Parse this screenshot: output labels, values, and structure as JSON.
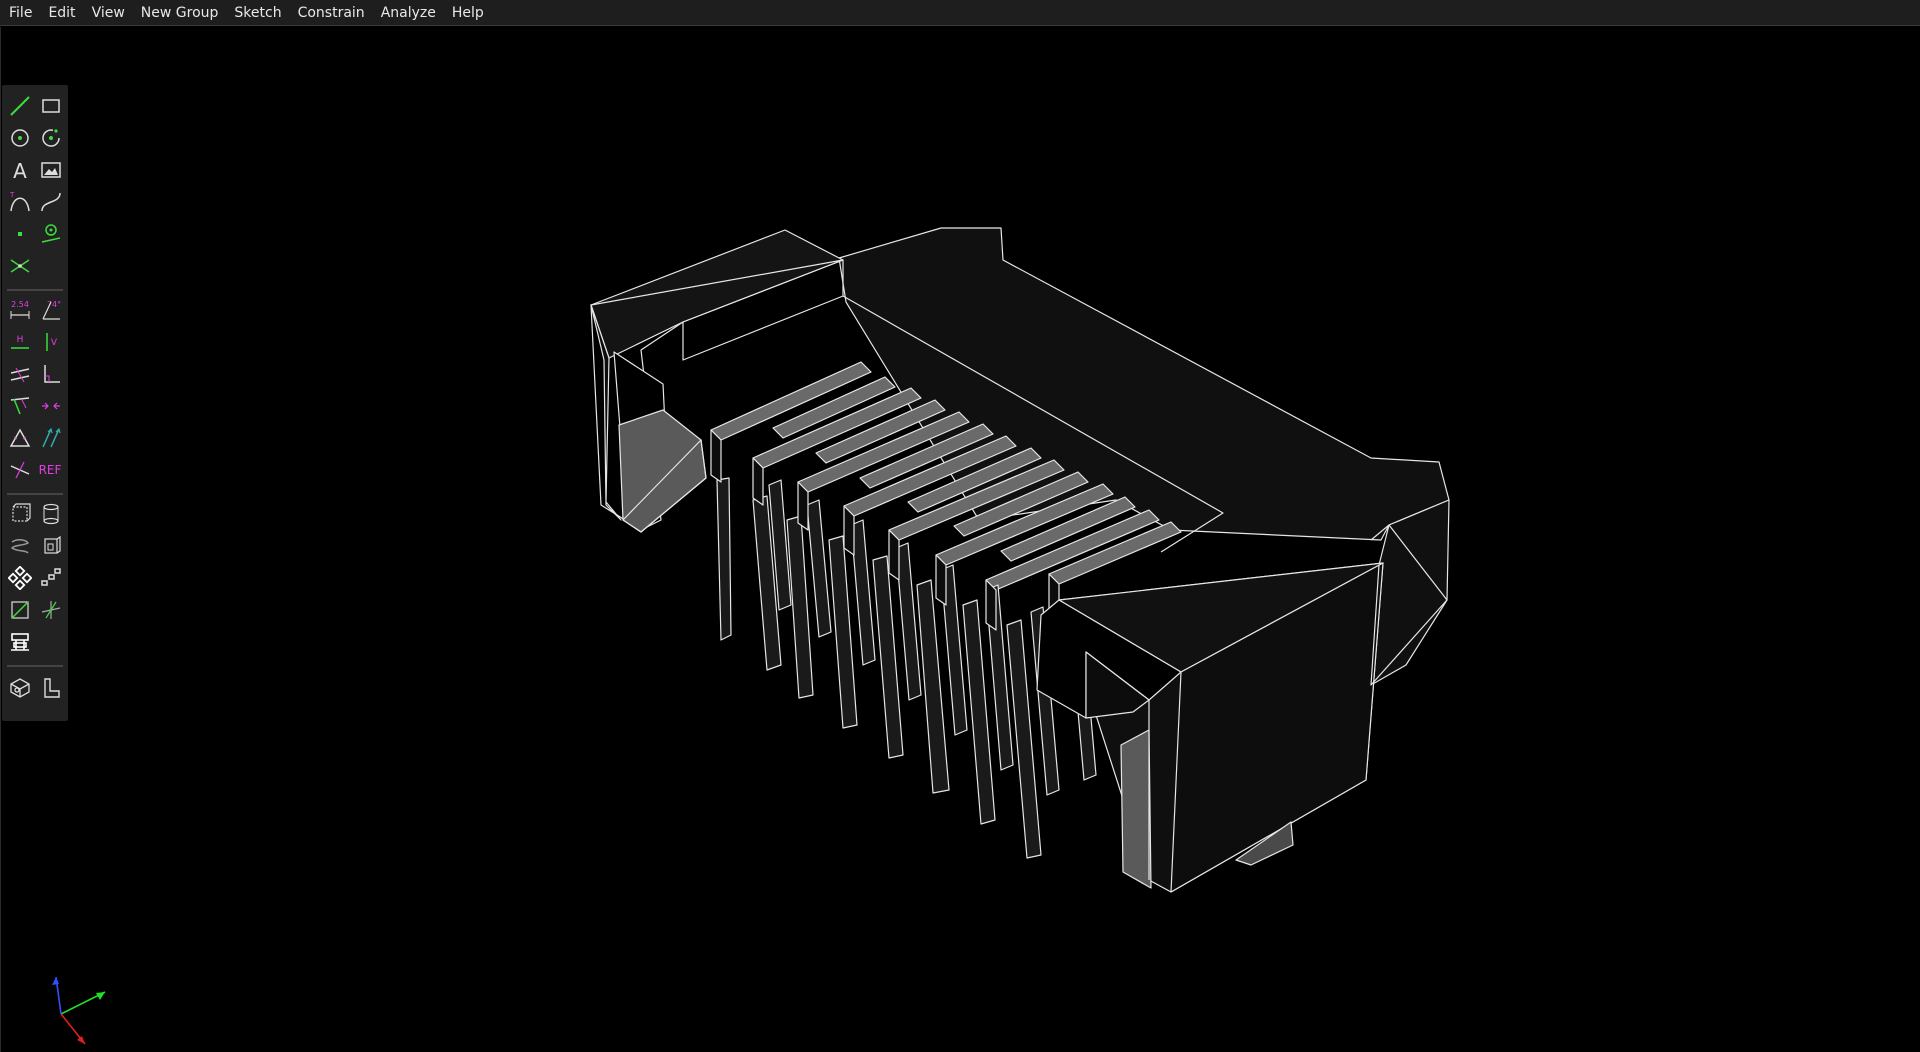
{
  "menubar": {
    "items": [
      {
        "label": "File"
      },
      {
        "label": "Edit"
      },
      {
        "label": "View"
      },
      {
        "label": "New Group"
      },
      {
        "label": "Sketch"
      },
      {
        "label": "Constrain"
      },
      {
        "label": "Analyze"
      },
      {
        "label": "Help"
      }
    ]
  },
  "toolbar": {
    "dimension_label": "2.54",
    "angle_label": "74°",
    "horizontal_label": "H",
    "vertical_label": "V",
    "reference_label": "REF",
    "text_label": "A",
    "tools": [
      "line-icon",
      "rectangle-icon",
      "circle-icon",
      "arc-icon",
      "text-icon",
      "image-icon",
      "tangent-arc-icon",
      "spline-icon",
      "point-icon",
      "workplane-icon",
      "split-curves-icon",
      "distance-icon",
      "angle-icon",
      "horizontal-icon",
      "vertical-icon",
      "parallel-icon",
      "perpendicular-icon",
      "point-on-line-icon",
      "symmetric-icon",
      "equal-icon",
      "same-orientation-icon",
      "other-angle-icon",
      "reference-icon",
      "extrude-icon",
      "lathe-icon",
      "helix-icon",
      "revolve-icon",
      "step-rotating-icon",
      "step-translating-icon",
      "workplane-group-icon",
      "sketch-in-3d-icon",
      "link-icon",
      "isometric-view-icon",
      "nearest-ortho-icon"
    ]
  },
  "colors": {
    "menu_bg": "#1e1e1e",
    "toolbar_bg": "#222222",
    "sketch_green": "#3cdc3c",
    "constraint_magenta": "#e040e0",
    "edge": "#e6e6e6",
    "face_dark": "#121212",
    "face_pin": "#6a6a6a",
    "axis_x": "#e02020",
    "axis_y": "#20e020",
    "axis_z": "#3050ff"
  }
}
